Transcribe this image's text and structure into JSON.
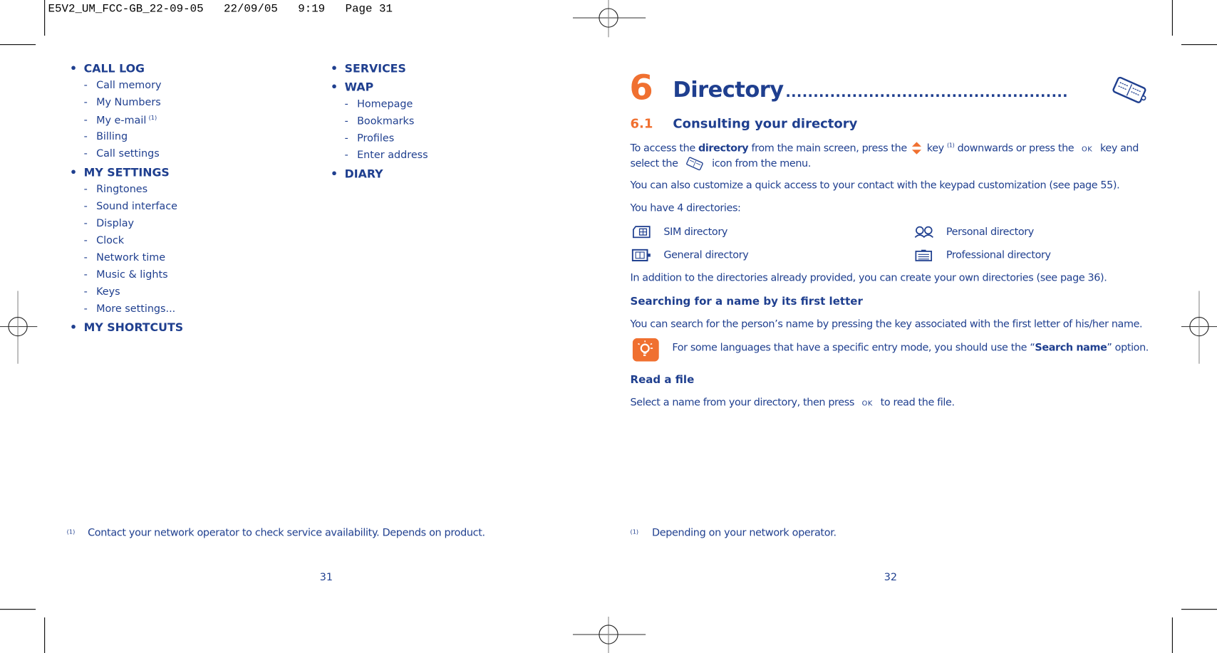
{
  "print_header": "E5V2_UM_FCC-GB_22-09-05   22/09/05   9:19   Page 31",
  "left_page": {
    "column1": [
      {
        "title": "CALL LOG",
        "items": [
          {
            "label": "Call memory"
          },
          {
            "label": "My Numbers"
          },
          {
            "label": "My e-mail",
            "note": "(1)"
          },
          {
            "label": "Billing"
          },
          {
            "label": "Call settings"
          }
        ]
      },
      {
        "title": "MY SETTINGS",
        "items": [
          {
            "label": "Ringtones"
          },
          {
            "label": "Sound interface"
          },
          {
            "label": "Display"
          },
          {
            "label": "Clock"
          },
          {
            "label": "Network time"
          },
          {
            "label": "Music & lights"
          },
          {
            "label": "Keys"
          },
          {
            "label": "More settings..."
          }
        ]
      },
      {
        "title": "MY SHORTCUTS",
        "items": []
      }
    ],
    "column2": [
      {
        "title": "SERVICES",
        "items": []
      },
      {
        "title": "WAP",
        "items": [
          {
            "label": "Homepage"
          },
          {
            "label": "Bookmarks"
          },
          {
            "label": "Profiles"
          },
          {
            "label": "Enter address"
          }
        ]
      },
      {
        "title": "DIARY",
        "items": []
      }
    ],
    "bullet": "•",
    "dash": "-",
    "footnote": {
      "marker": "(1)",
      "text": "Contact your network operator to check service availability. Depends on product."
    },
    "page_number": "31"
  },
  "right_page": {
    "chapter": {
      "number": "6",
      "title": "Directory",
      "leader": "...................................................",
      "icon": "directory-book-icon"
    },
    "section": {
      "number": "6.1",
      "title": "Consulting your directory"
    },
    "access_para": {
      "part1": "To access the ",
      "bold": "directory",
      "part2": " from the main screen, press the ",
      "part3": " key ",
      "note": "(1)",
      "part4": " downwards or press the ",
      "ok": "OK",
      "part5": " key and",
      "line2_a": "select the ",
      "line2_b": " icon from the menu."
    },
    "customize_para": "You can also customize a quick access to your contact with the keypad customization (see page 55).",
    "have_dirs": "You have 4 directories:",
    "directories": [
      {
        "label": "SIM directory",
        "icon": "sim-card-icon"
      },
      {
        "label": "Personal directory",
        "icon": "people-icon"
      },
      {
        "label": "General directory",
        "icon": "address-book-icon"
      },
      {
        "label": "Professional directory",
        "icon": "briefcase-icon"
      }
    ],
    "additional_para": "In addition to the directories already provided, you can create your own directories (see page 36).",
    "search_heading": "Searching for a name by its first letter",
    "search_para": "You can search for the person’s name by pressing the key associated with the first letter of his/her name.",
    "tip": {
      "part1": "For some languages that have a specific entry mode, you should use the “",
      "bold": "Search name",
      "part2": "” option.",
      "icon": "lightbulb-tip-icon"
    },
    "read_heading": "Read a file",
    "read_para": {
      "part1": "Select a name from your directory, then press ",
      "ok": "OK",
      "part2": " to read the file."
    },
    "footnote": {
      "marker": "(1)",
      "text": "Depending on your network operator."
    },
    "page_number": "32"
  },
  "colors": {
    "text": "#1f3f8f",
    "accent": "#f07030"
  }
}
